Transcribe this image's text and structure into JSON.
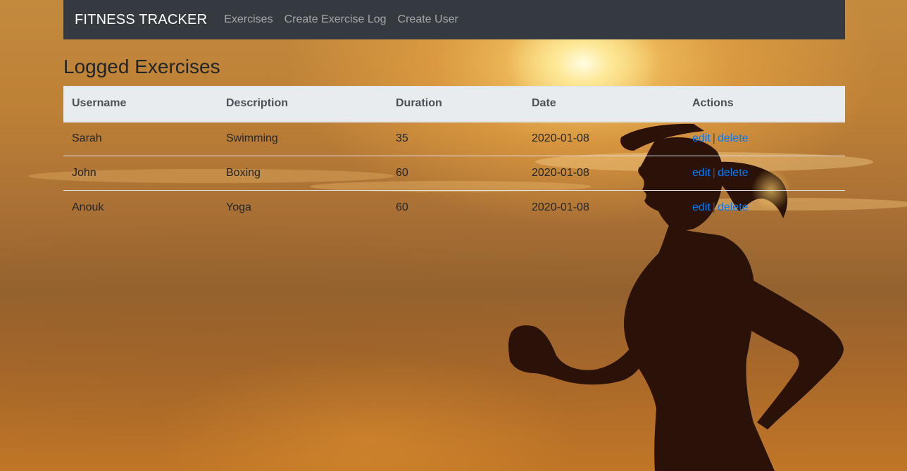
{
  "navbar": {
    "brand": "FITNESS TRACKER",
    "links": [
      {
        "label": "Exercises"
      },
      {
        "label": "Create Exercise Log"
      },
      {
        "label": "Create User"
      }
    ]
  },
  "page": {
    "title": "Logged Exercises"
  },
  "table": {
    "headers": [
      "Username",
      "Description",
      "Duration",
      "Date",
      "Actions"
    ],
    "rows": [
      {
        "username": "Sarah",
        "description": "Swimming",
        "duration": "35",
        "date": "2020-01-08"
      },
      {
        "username": "John",
        "description": "Boxing",
        "duration": "60",
        "date": "2020-01-08"
      },
      {
        "username": "Anouk",
        "description": "Yoga",
        "duration": "60",
        "date": "2020-01-08"
      }
    ],
    "actions": {
      "edit_label": "edit",
      "separator": "|",
      "delete_label": "delete"
    }
  },
  "colors": {
    "navbar_bg": "#343a40",
    "table_header_bg": "#e9ecef",
    "link": "#007bff"
  },
  "background": {
    "subject": "runner-silhouette-at-sunset"
  }
}
